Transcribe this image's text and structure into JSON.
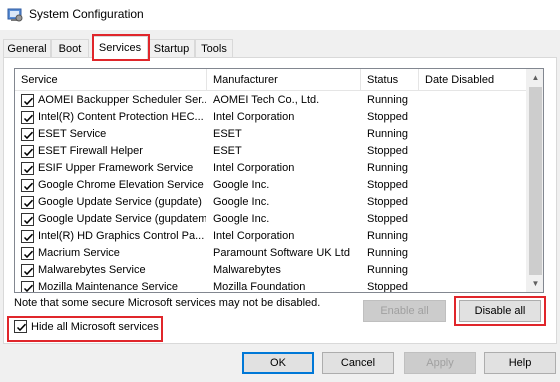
{
  "window": {
    "title": "System Configuration",
    "icon": "msconfig-icon"
  },
  "tabs": [
    {
      "label": "General",
      "active": false
    },
    {
      "label": "Boot",
      "active": false
    },
    {
      "label": "Services",
      "active": true
    },
    {
      "label": "Startup",
      "active": false
    },
    {
      "label": "Tools",
      "active": false
    }
  ],
  "columns": {
    "service": "Service",
    "manufacturer": "Manufacturer",
    "status": "Status",
    "date_disabled": "Date Disabled"
  },
  "services": [
    {
      "name": "AOMEI Backupper Scheduler Ser...",
      "manufacturer": "AOMEI Tech Co., Ltd.",
      "status": "Running",
      "date_disabled": "",
      "checked": true
    },
    {
      "name": "Intel(R) Content Protection HEC...",
      "manufacturer": "Intel Corporation",
      "status": "Stopped",
      "date_disabled": "",
      "checked": true
    },
    {
      "name": "ESET Service",
      "manufacturer": "ESET",
      "status": "Running",
      "date_disabled": "",
      "checked": true
    },
    {
      "name": "ESET Firewall Helper",
      "manufacturer": "ESET",
      "status": "Stopped",
      "date_disabled": "",
      "checked": true
    },
    {
      "name": "ESIF Upper Framework Service",
      "manufacturer": "Intel Corporation",
      "status": "Running",
      "date_disabled": "",
      "checked": true
    },
    {
      "name": "Google Chrome Elevation Service",
      "manufacturer": "Google Inc.",
      "status": "Stopped",
      "date_disabled": "",
      "checked": true
    },
    {
      "name": "Google Update Service (gupdate)",
      "manufacturer": "Google Inc.",
      "status": "Stopped",
      "date_disabled": "",
      "checked": true
    },
    {
      "name": "Google Update Service (gupdatem)",
      "manufacturer": "Google Inc.",
      "status": "Stopped",
      "date_disabled": "",
      "checked": true
    },
    {
      "name": "Intel(R) HD Graphics Control Pa...",
      "manufacturer": "Intel Corporation",
      "status": "Running",
      "date_disabled": "",
      "checked": true
    },
    {
      "name": "Macrium Service",
      "manufacturer": "Paramount Software UK Ltd",
      "status": "Running",
      "date_disabled": "",
      "checked": true
    },
    {
      "name": "Malwarebytes Service",
      "manufacturer": "Malwarebytes",
      "status": "Running",
      "date_disabled": "",
      "checked": true
    },
    {
      "name": "Mozilla Maintenance Service",
      "manufacturer": "Mozilla Foundation",
      "status": "Stopped",
      "date_disabled": "",
      "checked": true
    }
  ],
  "note": "Note that some secure Microsoft services may not be disabled.",
  "buttons": {
    "enable_all": "Enable all",
    "disable_all": "Disable all",
    "ok": "OK",
    "cancel": "Cancel",
    "apply": "Apply",
    "help": "Help"
  },
  "hide_ms": {
    "label": "Hide all Microsoft services",
    "checked": true
  },
  "colors": {
    "highlight": "#e0262b",
    "focus": "#0078d7"
  }
}
